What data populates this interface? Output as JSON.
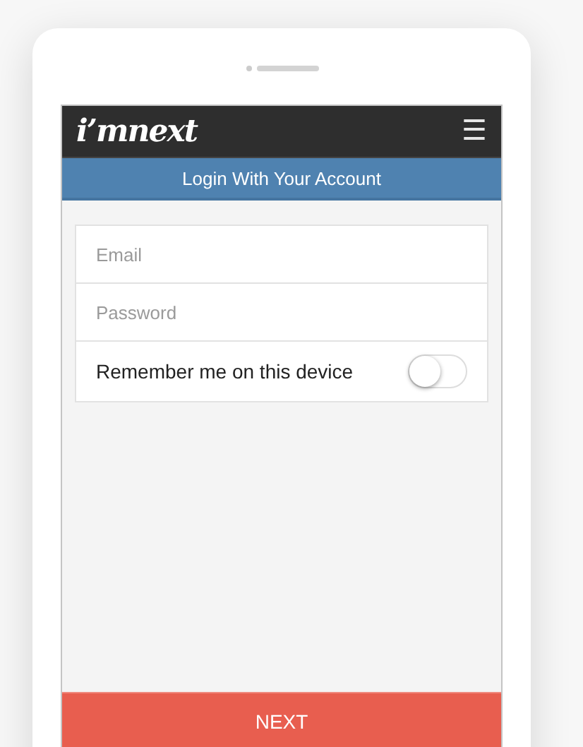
{
  "header": {
    "logo": "i’mnext",
    "menu_icon": "☰"
  },
  "banner": {
    "title": "Login With Your Account"
  },
  "form": {
    "email": {
      "placeholder": "Email"
    },
    "password": {
      "placeholder": "Password"
    },
    "remember": {
      "label": "Remember me on this device",
      "on": false
    }
  },
  "next_button": {
    "label": "NEXT"
  }
}
